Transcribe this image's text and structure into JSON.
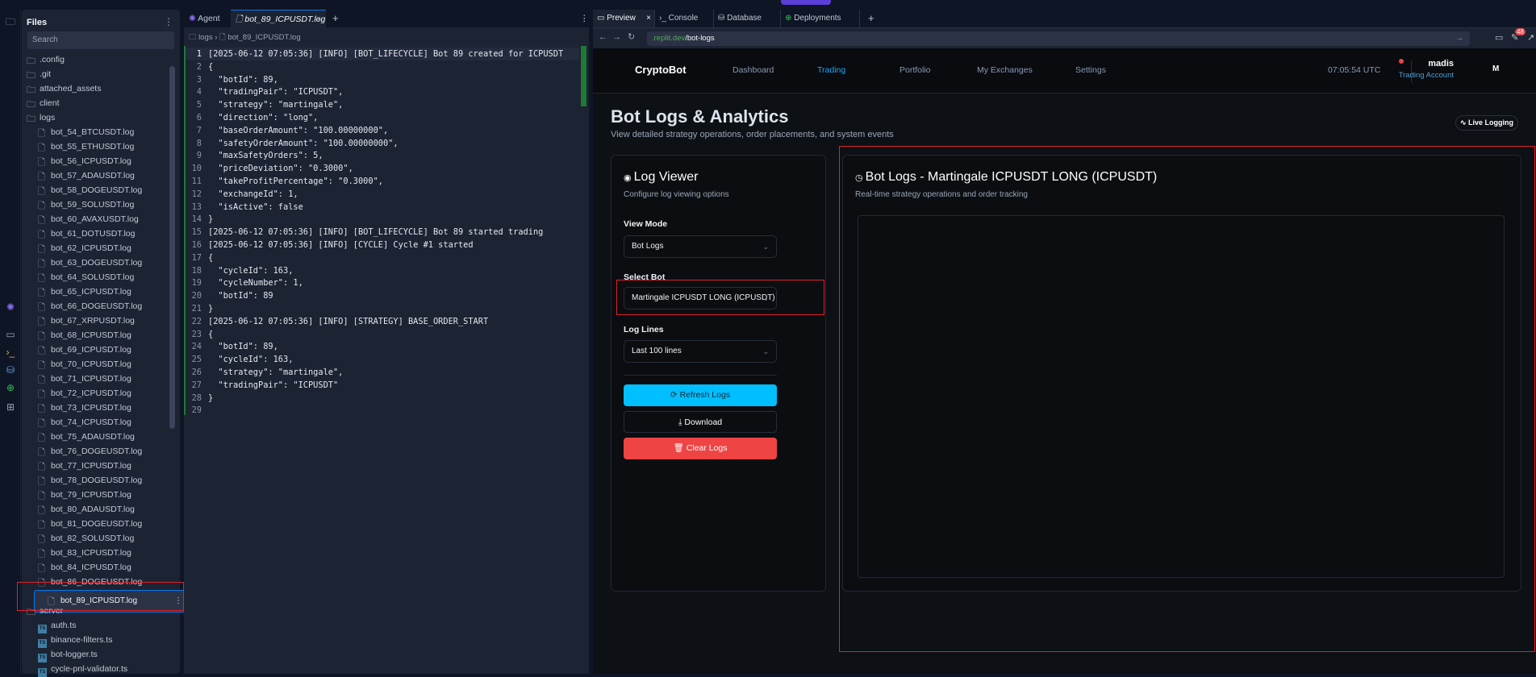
{
  "files_panel": {
    "title": "Files",
    "search_placeholder": "Search",
    "items": [
      {
        "name": ".config",
        "type": "folder",
        "depth": 0
      },
      {
        "name": ".git",
        "type": "folder",
        "depth": 0
      },
      {
        "name": "attached_assets",
        "type": "folder",
        "depth": 0
      },
      {
        "name": "client",
        "type": "folder",
        "depth": 0
      },
      {
        "name": "logs",
        "type": "folder",
        "depth": 0
      },
      {
        "name": "bot_54_BTCUSDT.log",
        "type": "file",
        "depth": 1
      },
      {
        "name": "bot_55_ETHUSDT.log",
        "type": "file",
        "depth": 1
      },
      {
        "name": "bot_56_ICPUSDT.log",
        "type": "file",
        "depth": 1
      },
      {
        "name": "bot_57_ADAUSDT.log",
        "type": "file",
        "depth": 1
      },
      {
        "name": "bot_58_DOGEUSDT.log",
        "type": "file",
        "depth": 1
      },
      {
        "name": "bot_59_SOLUSDT.log",
        "type": "file",
        "depth": 1
      },
      {
        "name": "bot_60_AVAXUSDT.log",
        "type": "file",
        "depth": 1
      },
      {
        "name": "bot_61_DOTUSDT.log",
        "type": "file",
        "depth": 1
      },
      {
        "name": "bot_62_ICPUSDT.log",
        "type": "file",
        "depth": 1
      },
      {
        "name": "bot_63_DOGEUSDT.log",
        "type": "file",
        "depth": 1
      },
      {
        "name": "bot_64_SOLUSDT.log",
        "type": "file",
        "depth": 1
      },
      {
        "name": "bot_65_ICPUSDT.log",
        "type": "file",
        "depth": 1
      },
      {
        "name": "bot_66_DOGEUSDT.log",
        "type": "file",
        "depth": 1
      },
      {
        "name": "bot_67_XRPUSDT.log",
        "type": "file",
        "depth": 1
      },
      {
        "name": "bot_68_ICPUSDT.log",
        "type": "file",
        "depth": 1
      },
      {
        "name": "bot_69_ICPUSDT.log",
        "type": "file",
        "depth": 1
      },
      {
        "name": "bot_70_ICPUSDT.log",
        "type": "file",
        "depth": 1
      },
      {
        "name": "bot_71_ICPUSDT.log",
        "type": "file",
        "depth": 1
      },
      {
        "name": "bot_72_ICPUSDT.log",
        "type": "file",
        "depth": 1
      },
      {
        "name": "bot_73_ICPUSDT.log",
        "type": "file",
        "depth": 1
      },
      {
        "name": "bot_74_ICPUSDT.log",
        "type": "file",
        "depth": 1
      },
      {
        "name": "bot_75_ADAUSDT.log",
        "type": "file",
        "depth": 1
      },
      {
        "name": "bot_76_DOGEUSDT.log",
        "type": "file",
        "depth": 1
      },
      {
        "name": "bot_77_ICPUSDT.log",
        "type": "file",
        "depth": 1
      },
      {
        "name": "bot_78_DOGEUSDT.log",
        "type": "file",
        "depth": 1
      },
      {
        "name": "bot_79_ICPUSDT.log",
        "type": "file",
        "depth": 1
      },
      {
        "name": "bot_80_ADAUSDT.log",
        "type": "file",
        "depth": 1
      },
      {
        "name": "bot_81_DOGEUSDT.log",
        "type": "file",
        "depth": 1
      },
      {
        "name": "bot_82_SOLUSDT.log",
        "type": "file",
        "depth": 1
      },
      {
        "name": "bot_83_ICPUSDT.log",
        "type": "file",
        "depth": 1
      },
      {
        "name": "bot_84_ICPUSDT.log",
        "type": "file",
        "depth": 1
      },
      {
        "name": "bot_86_DOGEUSDT.log",
        "type": "file",
        "depth": 1
      },
      {
        "name": "bot_89_ICPUSDT.log",
        "type": "file",
        "depth": 1,
        "selected": true
      },
      {
        "name": "server",
        "type": "folder",
        "depth": 0
      },
      {
        "name": "auth.ts",
        "type": "ts",
        "depth": 1
      },
      {
        "name": "binance-filters.ts",
        "type": "ts",
        "depth": 1
      },
      {
        "name": "bot-logger.ts",
        "type": "ts",
        "depth": 1
      },
      {
        "name": "cycle-pnl-validator.ts",
        "type": "ts",
        "depth": 1
      }
    ]
  },
  "editor": {
    "tabs": [
      {
        "label": "Agent"
      },
      {
        "label": "bot_89_ICPUSDT.log"
      }
    ],
    "breadcrumb": [
      "logs",
      "bot_89_ICPUSDT.log"
    ],
    "lines": [
      "[2025-06-12 07:05:36] [INFO] [BOT_LIFECYCLE] Bot 89 created for ICPUSDT",
      "{",
      "  \"botId\": 89,",
      "  \"tradingPair\": \"ICPUSDT\",",
      "  \"strategy\": \"martingale\",",
      "  \"direction\": \"long\",",
      "  \"baseOrderAmount\": \"100.00000000\",",
      "  \"safetyOrderAmount\": \"100.00000000\",",
      "  \"maxSafetyOrders\": 5,",
      "  \"priceDeviation\": \"0.3000\",",
      "  \"takeProfitPercentage\": \"0.3000\",",
      "  \"exchangeId\": 1,",
      "  \"isActive\": false",
      "}",
      "[2025-06-12 07:05:36] [INFO] [BOT_LIFECYCLE] Bot 89 started trading",
      "[2025-06-12 07:05:36] [INFO] [CYCLE] Cycle #1 started",
      "{",
      "  \"cycleId\": 163,",
      "  \"cycleNumber\": 1,",
      "  \"botId\": 89",
      "}",
      "[2025-06-12 07:05:36] [INFO] [STRATEGY] BASE_ORDER_START",
      "{",
      "  \"botId\": 89,",
      "  \"cycleId\": 163,",
      "  \"strategy\": \"martingale\",",
      "  \"tradingPair\": \"ICPUSDT\"",
      "}",
      ""
    ]
  },
  "preview": {
    "tabs": [
      {
        "label": "Preview"
      },
      {
        "label": "Console"
      },
      {
        "label": "Database"
      },
      {
        "label": "Deployments"
      }
    ],
    "url_domain": ".replit.dev",
    "url_path": "/bot-logs",
    "badge_count": "48"
  },
  "app": {
    "brand": "CryptoBot",
    "nav": [
      "Dashboard",
      "Trading",
      "Portfolio",
      "My Exchanges",
      "Settings"
    ],
    "active_nav": "Trading",
    "time": "07:05:54 UTC",
    "user_name": "madis",
    "user_account": "Trading Account",
    "avatar_initial": "M",
    "page_title": "Bot Logs & Analytics",
    "page_subtitle": "View detailed strategy operations, order placements, and system events",
    "live_logging": "Live Logging",
    "log_viewer": {
      "title": "Log Viewer",
      "subtitle": "Configure log viewing options",
      "view_mode_label": "View Mode",
      "view_mode_value": "Bot Logs",
      "select_bot_label": "Select Bot",
      "select_bot_value": "Martingale ICPUSDT LONG (ICPUSDT)",
      "log_lines_label": "Log Lines",
      "log_lines_value": "Last 100 lines",
      "refresh": "Refresh Logs",
      "download": "Download",
      "clear": "Clear Logs"
    },
    "bot_logs": {
      "title": "Bot Logs - Martingale ICPUSDT LONG (ICPUSDT)",
      "subtitle": "Real-time strategy operations and order tracking"
    }
  },
  "colors": {
    "accent": "#00bfff",
    "danger": "#ef4444",
    "active_nav": "#1ea7fd",
    "replit_blue": "#0079f2"
  }
}
